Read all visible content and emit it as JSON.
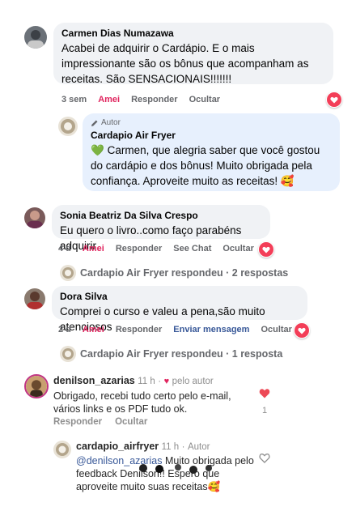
{
  "comments": [
    {
      "author": "Carmen Dias Numazawa",
      "text": "Acabei de adquirir o Cardápio. E o mais impressionante são os bônus que acompanham as receitas. São SENSACIONAIS!!!!!!!",
      "time": "3 sem",
      "like_label": "Amei",
      "reply_label": "Responder",
      "hide_label": "Ocultar"
    },
    {
      "author_badge": "Autor",
      "author": "Cardapio Air Fryer",
      "text": "Carmen, que alegria saber que você gostou do cardápio e dos bônus! Muito obrigada pela confiança. Aproveite muito as receitas!",
      "leading_emoji": "💚",
      "trailing_emoji": "🥰"
    },
    {
      "author": "Sonia Beatriz Da Silva Crespo",
      "text": "Eu quero o livro..como faço parabéns adquirir",
      "time": "4 d",
      "like_label": "Amei",
      "reply_label": "Responder",
      "see_chat_label": "See Chat",
      "hide_label": "Ocultar",
      "replies_text": "Cardapio Air Fryer respondeu · 2 respostas"
    },
    {
      "author": "Dora Silva",
      "text": "Comprei o curso e valeu a pena,são muito atenciosos",
      "time": "2 d",
      "like_label": "Amei",
      "reply_label": "Responder",
      "send_message_label": "Enviar mensagem",
      "hide_label": "Ocultar",
      "replies_text": "Cardapio Air Fryer respondeu · 1 resposta"
    }
  ],
  "instagram": {
    "comment": {
      "username": "denilson_azarias",
      "time": "11 h",
      "liked_by_author": "pelo autor",
      "text": "Obrigado,  recebi tudo certo pelo e-mail, vários links e os PDF tudo ok.",
      "reply_label": "Responder",
      "hide_label": "Ocultar",
      "like_count": "1"
    },
    "reply": {
      "username": "cardapio_airfryer",
      "time": "11 h",
      "badge": "Autor",
      "mention": "@denilson_azarias",
      "text": " Muito obrigada pelo feedback Denilson!! Espero que aproveite muito suas receitas",
      "emoji": "🥰"
    }
  },
  "colors": {
    "liked": "#e0245e",
    "link_blue": "#385898",
    "bubble": "#f0f2f5",
    "author_bubble": "#e7f0fd"
  },
  "icons": [
    "heart-icon",
    "pencil-icon",
    "heart-outline-icon",
    "avatar"
  ]
}
